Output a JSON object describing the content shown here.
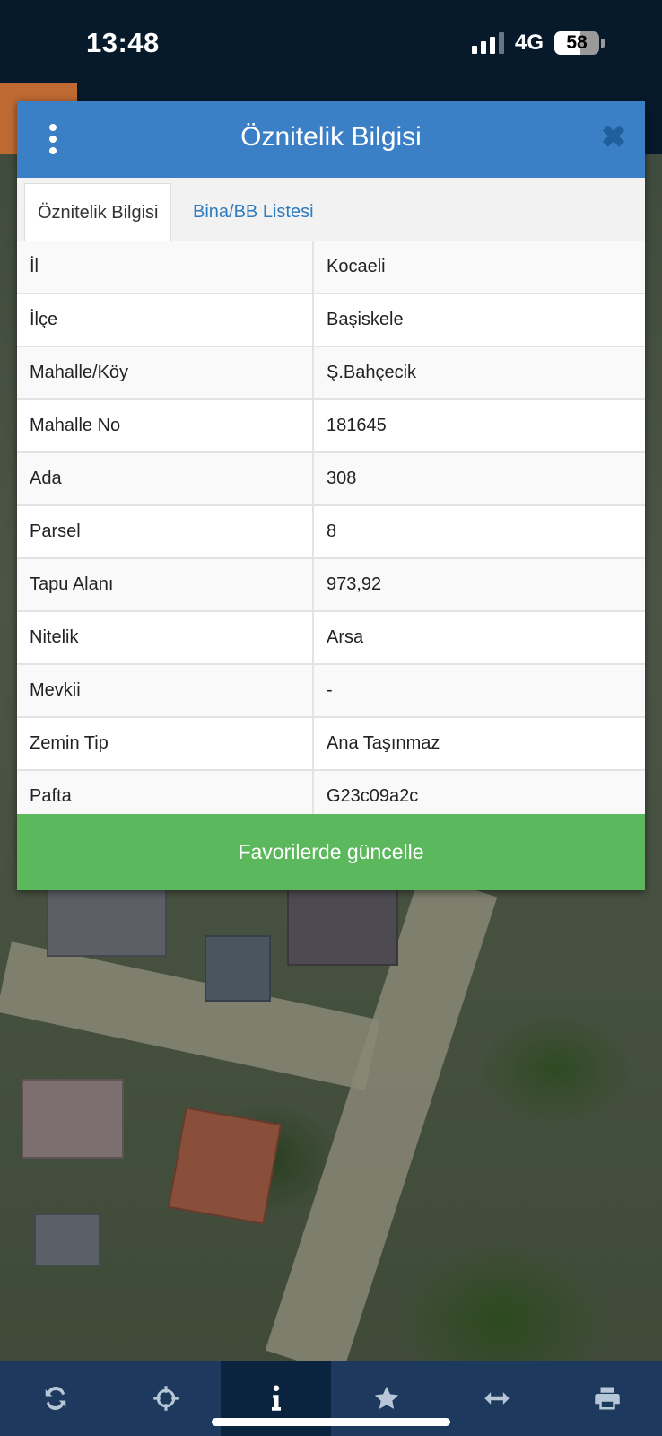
{
  "status_bar": {
    "time": "13:48",
    "network": "4G",
    "battery": "58",
    "battery_level": 0.58
  },
  "dialog": {
    "title": "Öznitelik Bilgisi",
    "tabs": [
      {
        "label": "Öznitelik Bilgisi"
      },
      {
        "label": "Bina/BB Listesi"
      }
    ],
    "rows": [
      {
        "key": "İl",
        "value": "Kocaeli"
      },
      {
        "key": "İlçe",
        "value": "Başiskele"
      },
      {
        "key": "Mahalle/Köy",
        "value": "Ş.Bahçecik"
      },
      {
        "key": "Mahalle No",
        "value": "181645"
      },
      {
        "key": "Ada",
        "value": "308"
      },
      {
        "key": "Parsel",
        "value": "8"
      },
      {
        "key": "Tapu Alanı",
        "value": "973,92"
      },
      {
        "key": "Nitelik",
        "value": "Arsa"
      },
      {
        "key": "Mevkii",
        "value": "-"
      },
      {
        "key": "Zemin Tip",
        "value": "Ana Taşınmaz"
      },
      {
        "key": "Pafta",
        "value": "G23c09a2c"
      }
    ],
    "favorite_button": "Favorilerde güncelle"
  },
  "toolbar": {
    "items": [
      {
        "icon": "refresh-icon"
      },
      {
        "icon": "crosshair-icon"
      },
      {
        "icon": "info-icon"
      },
      {
        "icon": "star-icon"
      },
      {
        "icon": "measure-icon"
      },
      {
        "icon": "print-icon"
      }
    ]
  },
  "colors": {
    "header": "#3b80c6",
    "button": "#5cb85c",
    "toolbar": "#1d3a5e",
    "tab_link": "#2f7bbf"
  }
}
